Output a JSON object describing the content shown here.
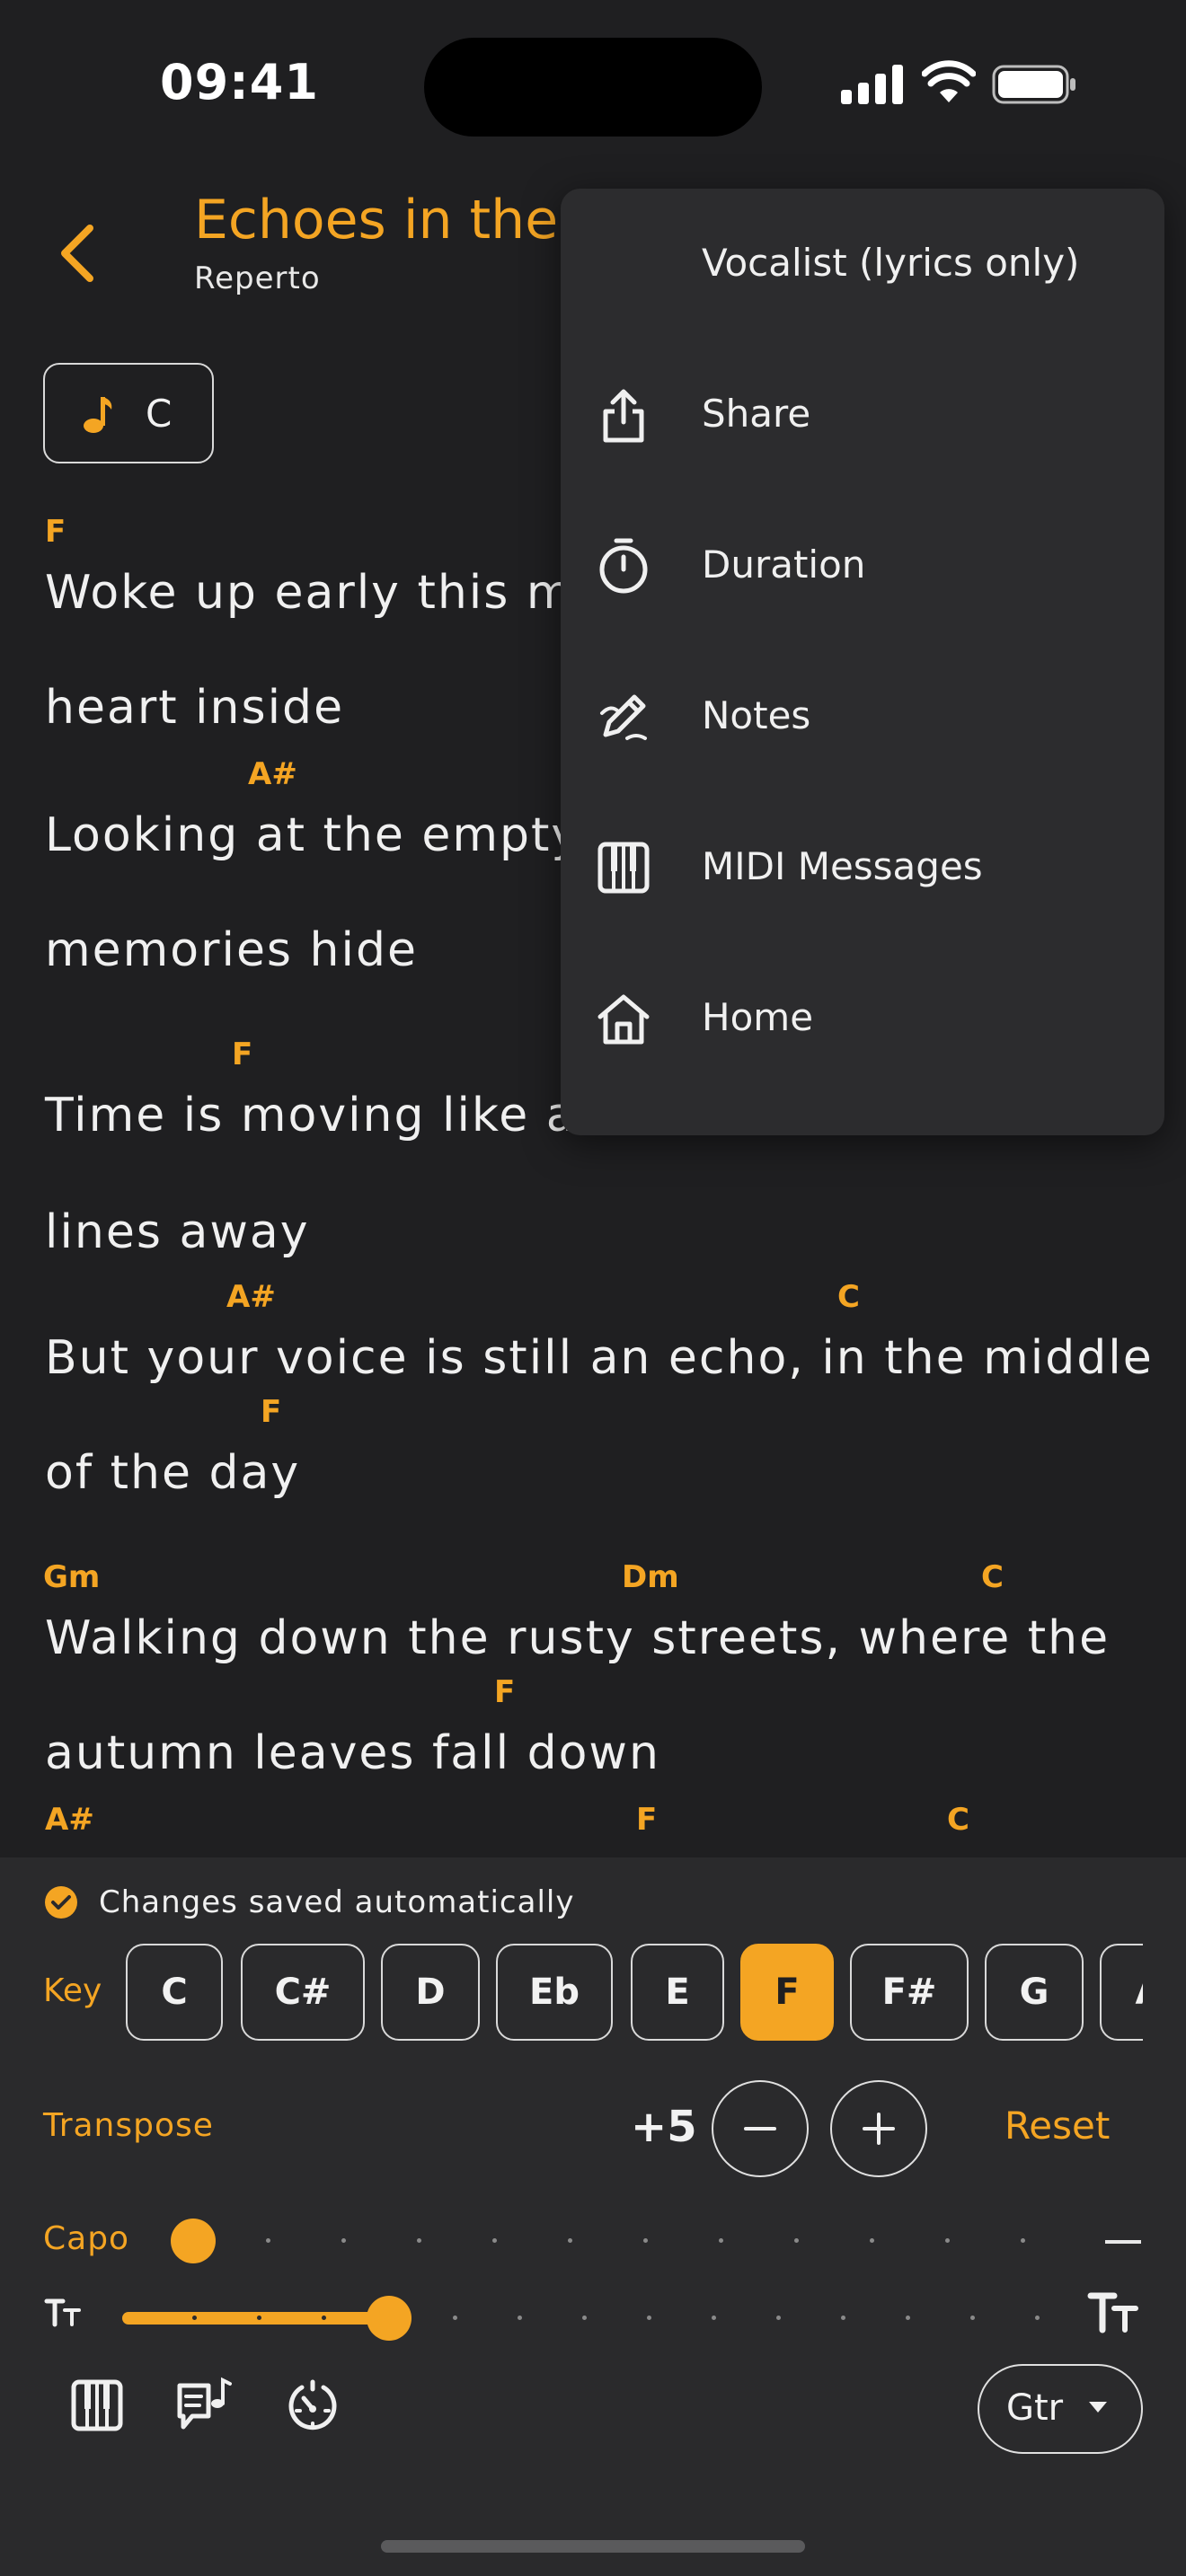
{
  "status": {
    "time": "09:41",
    "icons": [
      "signal-icon",
      "wifi-icon",
      "battery-icon"
    ]
  },
  "header": {
    "title": "Echoes in the R",
    "subtitle": "Reperto",
    "back_icon": "chevron-left-icon"
  },
  "key_badge": {
    "icon": "music-note-icon",
    "value": "C"
  },
  "lyrics": [
    {
      "chords": [
        {
          "text": "F"
        }
      ],
      "text": "Woke up early this mo"
    },
    {
      "chords": [],
      "text": "heart inside"
    },
    {
      "chords": [
        {
          "text": "A#"
        }
      ],
      "text": "Looking at the empty"
    },
    {
      "chords": [],
      "text": "memories hide"
    },
    {
      "chords": [
        {
          "text": "F"
        }
      ],
      "text": "Time is moving like a"
    },
    {
      "chords": [],
      "text": "lines away"
    },
    {
      "chords": [
        {
          "text": "A#"
        },
        {
          "text": "C"
        }
      ],
      "text": "But your voice is still an echo, in the middle"
    },
    {
      "chords": [
        {
          "text": "F"
        }
      ],
      "text": "of the day"
    },
    {
      "chords": [
        {
          "text": "Gm"
        },
        {
          "text": "Dm"
        },
        {
          "text": "C"
        }
      ],
      "text": "Walking down the rusty streets, where the"
    },
    {
      "chords": [
        {
          "text": "F"
        }
      ],
      "text": "autumn leaves fall down"
    },
    {
      "chords": [
        {
          "text": "A#"
        },
        {
          "text": "F"
        },
        {
          "text": "C"
        }
      ],
      "text": ""
    }
  ],
  "menu": {
    "items": [
      {
        "label": "Vocalist (lyrics only)",
        "icon": ""
      },
      {
        "label": "Share",
        "icon": "share-icon"
      },
      {
        "label": "Duration",
        "icon": "stopwatch-icon"
      },
      {
        "label": "Notes",
        "icon": "pencil-icon"
      },
      {
        "label": "MIDI Messages",
        "icon": "piano-icon"
      },
      {
        "label": "Home",
        "icon": "home-icon"
      }
    ]
  },
  "panel": {
    "saved_text": "Changes saved automatically",
    "key_label": "Key",
    "keys": [
      "C",
      "C#",
      "D",
      "Eb",
      "E",
      "F",
      "F#",
      "G",
      "A"
    ],
    "selected_key": "F",
    "transpose_label": "Transpose",
    "transpose_value": "+5",
    "minus_label": "−",
    "plus_label": "+",
    "reset_label": "Reset",
    "capo_label": "Capo",
    "capo_value_text": "—",
    "capo_level": 0,
    "font_size_level": 0.29,
    "gtr_label": "Gtr",
    "toolbar_icons": [
      "piano-icon",
      "lyrics-music-icon",
      "metronome-icon"
    ]
  },
  "colors": {
    "accent": "#f4a523",
    "background": "#1f1f21",
    "panel": "#2a2a2c",
    "menu": "#2c2c2e"
  }
}
